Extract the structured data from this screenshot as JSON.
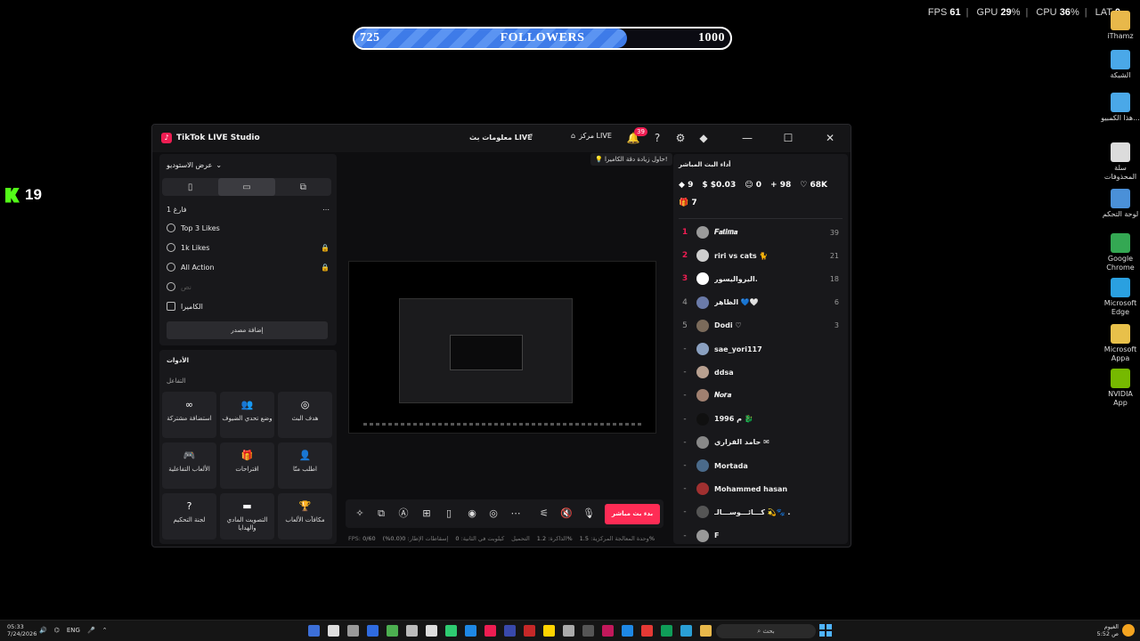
{
  "perf_overlay": {
    "fps_label": "FPS",
    "fps": "61",
    "gpu_label": "GPU",
    "gpu": "29",
    "cpu_label": "CPU",
    "cpu": "36",
    "unit": "%",
    "lat_label": "LAT",
    "lat": "0"
  },
  "goal": {
    "current": "725",
    "title": "FOLLOWERS",
    "max": "1000",
    "progress": 0.725
  },
  "kick": {
    "count": "19"
  },
  "desktop_icons": [
    {
      "label": "iThamz",
      "color": "#e8b84a"
    },
    {
      "label": "الشبكة",
      "color": "#4aa8e8"
    },
    {
      "label": "هذا الكمبيو...",
      "color": "#4aa8e8"
    },
    {
      "label": "سلة المحذوفات",
      "color": "#dcdcdc"
    },
    {
      "label": "لوحة التحكم",
      "color": "#4a90d8"
    },
    {
      "label": "Google Chrome",
      "color": "#34a853"
    },
    {
      "label": "Microsoft Edge",
      "color": "#2aa0e0"
    },
    {
      "label": "Microsoft Appa",
      "color": "#e8c04a"
    },
    {
      "label": "NVIDIA App",
      "color": "#76b900"
    }
  ],
  "window": {
    "title": "TikTok LIVE Studio",
    "stream_info": "معلومات بث LIVE",
    "live_center": "مركز LIVE",
    "notif_count": "39"
  },
  "left_panel": {
    "studio_view": "عرض الاستوديو",
    "scene": "فارغ 1",
    "sources": [
      {
        "label": "Top 3 Likes",
        "locked": false
      },
      {
        "label": "1k Likes",
        "locked": true
      },
      {
        "label": "All Action",
        "locked": true
      },
      {
        "label": "نص",
        "locked": false
      },
      {
        "label": "الكاميرا",
        "locked": false
      }
    ],
    "add_source": "إضافة مصدر",
    "tools_title": "الأدوات",
    "interaction_title": "التفاعل",
    "tools": [
      {
        "label": "استضافة مشتركة",
        "icon": "∞"
      },
      {
        "label": "وضع تحدي الضيوف",
        "icon": "👥"
      },
      {
        "label": "هدف البث",
        "icon": "◎"
      },
      {
        "label": "الألعاب التفاعلية",
        "icon": "🎮"
      },
      {
        "label": "اقتراحات",
        "icon": "🎁"
      },
      {
        "label": "اطلب منّا",
        "icon": "👤"
      },
      {
        "label": "لجنة التحكيم",
        "icon": "?"
      },
      {
        "label": "التصويت المادي والهدايا",
        "icon": "▬"
      },
      {
        "label": "مكافآت الألعاب",
        "icon": "🏆"
      }
    ]
  },
  "preview": {
    "tip": "حاول زيادة دقة الكاميرا!"
  },
  "controls": {
    "go_live": "بدء بث مباشر"
  },
  "stats": [
    {
      "label": "FPS:",
      "value": "0/60"
    },
    {
      "label": "إسقاطات الإطار:",
      "value": "0(0.0%)"
    },
    {
      "label": "كيلوبت في الثانية:",
      "value": "0"
    },
    {
      "label": "التحميل",
      "value": ""
    },
    {
      "label": "الذاكرة:",
      "value": "1.2%"
    },
    {
      "label": "وحدة المعالجة المركزية:",
      "value": "1.5%"
    }
  ],
  "right_panel": {
    "title": "أداء البث المباشر",
    "kpis": {
      "gifts": "9",
      "money": "$0.03",
      "viewers": "0",
      "followers": "98",
      "likes": "68K",
      "boxes": "7"
    },
    "viewers": [
      {
        "rank": "1",
        "name": "𝑭𝒂𝒕𝒊𝒎𝒂",
        "score": "39",
        "color": "#9a9a9a"
      },
      {
        "rank": "2",
        "name": "riri vs cats 🐈",
        "score": "21",
        "color": "#cfcfcf"
      },
      {
        "rank": "3",
        "name": "اليرواليسور.",
        "score": "18",
        "color": "#ffffff"
      },
      {
        "rank": "4",
        "name": "الظاهر 💙🤍",
        "score": "6",
        "color": "#6a7aa8"
      },
      {
        "rank": "5",
        "name": "Dodi ♡",
        "score": "3",
        "color": "#7a6a5a"
      },
      {
        "rank": "-",
        "name": "sae_yori117",
        "score": "",
        "color": "#8aa0c0"
      },
      {
        "rank": "-",
        "name": "ddsa",
        "score": "",
        "color": "#b8a090"
      },
      {
        "rank": "-",
        "name": "𝑵𝒐𝒓𝒂",
        "score": "",
        "color": "#a08070"
      },
      {
        "rank": "-",
        "name": "1996 م 🐉",
        "score": "",
        "color": "#101010"
      },
      {
        "rank": "-",
        "name": "حامد الفزاري ✉",
        "score": "",
        "color": "#888888"
      },
      {
        "rank": "-",
        "name": "Mortada",
        "score": "",
        "color": "#4a6a8a"
      },
      {
        "rank": "-",
        "name": "Mohammed hasan",
        "score": "",
        "color": "#a03030"
      },
      {
        "rank": "-",
        "name": "كـــائـــوســـالـ 💫🐾 .",
        "score": "",
        "color": "#555555"
      },
      {
        "rank": "-",
        "name": "F",
        "score": "",
        "color": "#999999"
      }
    ]
  },
  "taskbar": {
    "time": "05:33",
    "date": "7/24/2026",
    "lang": "ENG",
    "search": "بحث",
    "weather_label": "الغيوم",
    "weather_sub": "5:52 ص"
  }
}
